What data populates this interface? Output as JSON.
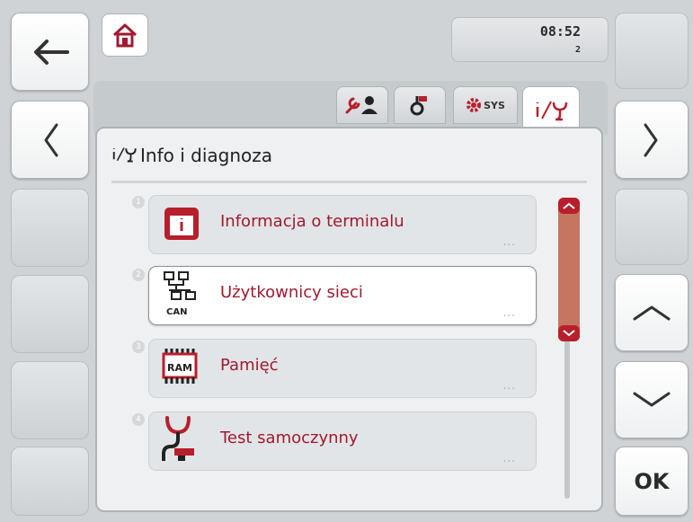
{
  "clock": {
    "time": "08:52",
    "sub": "2"
  },
  "tabs": [
    {
      "name": "tab-settings-user",
      "icon": "wrench-user-icon"
    },
    {
      "name": "tab-service",
      "icon": "service-icon"
    },
    {
      "name": "tab-system",
      "icon": "gear-sys-icon",
      "label": "SYS"
    },
    {
      "name": "tab-info-diagnosis",
      "icon": "info-diagnosis-icon",
      "active": true
    }
  ],
  "panel": {
    "title": "Info i diagnoza"
  },
  "items": [
    {
      "number": "1",
      "label": "Informacja o terminalu",
      "icon": "terminal-info-icon",
      "dots": "...",
      "selected": false
    },
    {
      "number": "2",
      "label": "Użytkownicy sieci",
      "icon": "can-network-icon",
      "icon_text": "CAN",
      "dots": "...",
      "selected": true
    },
    {
      "number": "3",
      "label": "Pamięć",
      "icon": "ram-memory-icon",
      "icon_text": "RAM",
      "dots": "...",
      "selected": false
    },
    {
      "number": "4",
      "label": "Test samoczynny",
      "icon": "stethoscope-icon",
      "dots": "...",
      "selected": false
    }
  ],
  "softkeys": {
    "ok_label": "OK"
  },
  "colors": {
    "accent": "#a01a30",
    "scroll_thumb": "#c67560",
    "scroll_cap": "#b81f2c"
  }
}
